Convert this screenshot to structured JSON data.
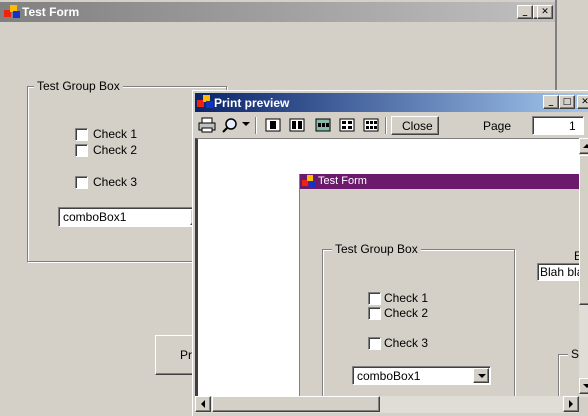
{
  "main_window": {
    "title": "Test Form",
    "group_box": {
      "legend": "Test Group Box",
      "checkboxes": [
        "Check 1",
        "Check 2",
        "Check 3"
      ],
      "combo_value": "comboBox1"
    },
    "partial_button_label": "Pr"
  },
  "preview_window": {
    "title": "Print preview",
    "toolbar": {
      "close_label": "Close",
      "page_label": "Page",
      "page_value": "1"
    },
    "page": {
      "form_title": "Test Form",
      "group_box": {
        "legend": "Test Group Box",
        "checkboxes": [
          "Check 1",
          "Check 2",
          "Check 3"
        ],
        "combo_value": "comboBox1"
      },
      "right_label": "E",
      "right_textbox": "Blah bla",
      "right_group_letter": "S"
    }
  },
  "colors": {
    "face": "#d4d0c8",
    "main_title_grad_start": "#808080",
    "main_title_grad_end": "#c0c0c0",
    "preview_title_start": "#0a246a",
    "preview_title_end": "#a6caf0",
    "page_title_bar": "#6c1a6c"
  }
}
